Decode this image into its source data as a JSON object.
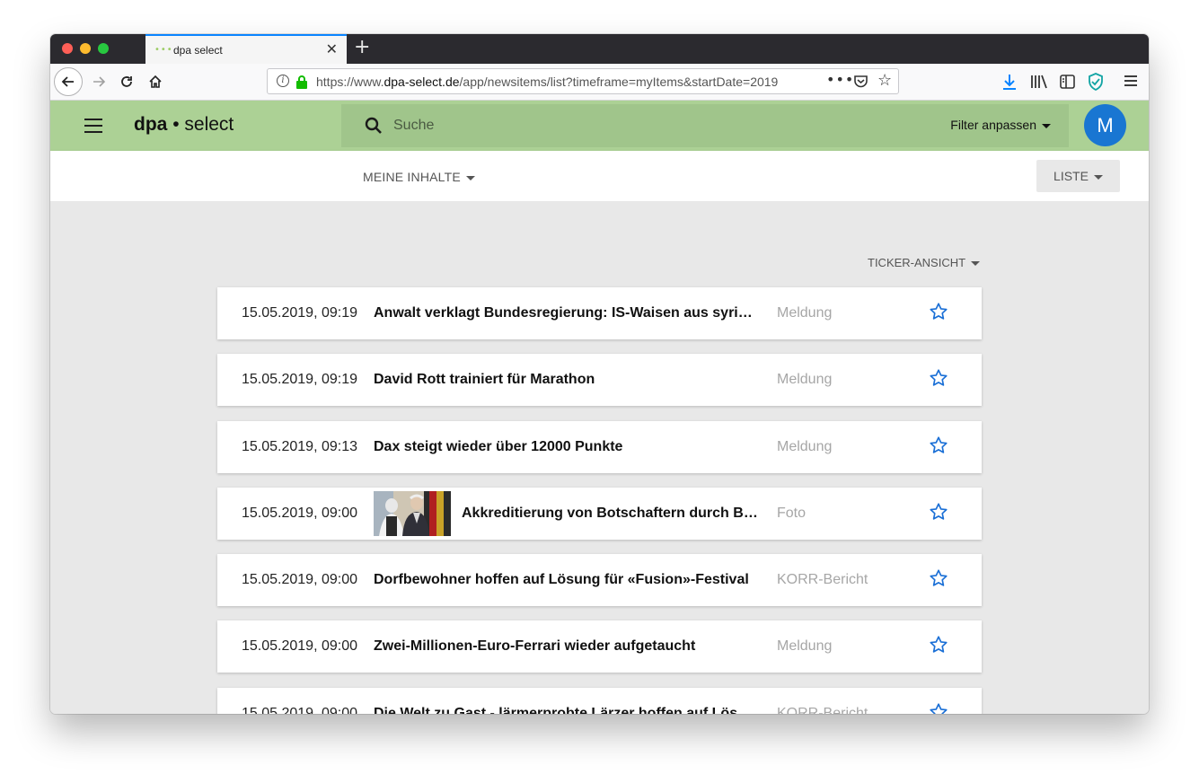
{
  "browser": {
    "tab_title": "dpa select",
    "tab_loading": "•••",
    "tab_close": "✕",
    "new_tab": "+",
    "url_prefix": "https://www.",
    "url_domain": "dpa-select.de",
    "url_path": "/app/newsitems/list?timeframe=myItems&startDate=2019",
    "url_more": "•••"
  },
  "app": {
    "logo_bold": "dpa",
    "logo_dot": "•",
    "logo_rest": "select",
    "search_placeholder": "Suche",
    "filter_label": "Filter anpassen",
    "avatar_initial": "M",
    "accent_color": "#acd195",
    "avatar_color": "#1976d2"
  },
  "subheader": {
    "section_label": "MEINE INHALTE",
    "view_label": "LISTE"
  },
  "content": {
    "ticker_label": "TICKER-ANSICHT",
    "items": [
      {
        "date": "15.05.2019, 09:19",
        "title": "Anwalt verklagt Bundesregierung: IS-Waisen aus syrischen Lagern",
        "type": "Meldung",
        "has_image": false
      },
      {
        "date": "15.05.2019, 09:19",
        "title": "David Rott trainiert für Marathon",
        "type": "Meldung",
        "has_image": false
      },
      {
        "date": "15.05.2019, 09:13",
        "title": "Dax steigt wieder über 12000 Punkte",
        "type": "Meldung",
        "has_image": false
      },
      {
        "date": "15.05.2019, 09:00",
        "title": "Akkreditierung von Botschaftern durch Bundespräsident",
        "type": "Foto",
        "has_image": true
      },
      {
        "date": "15.05.2019, 09:00",
        "title": "Dorfbewohner hoffen auf Lösung für «Fusion»-Festival",
        "type": "KORR-Bericht",
        "has_image": false
      },
      {
        "date": "15.05.2019, 09:00",
        "title": "Zwei-Millionen-Euro-Ferrari wieder aufgetaucht",
        "type": "Meldung",
        "has_image": false
      },
      {
        "date": "15.05.2019, 09:00",
        "title": "Die Welt zu Gast - lärmerprobte Lärzer hoffen auf Lösung",
        "type": "KORR-Bericht",
        "has_image": false
      }
    ]
  }
}
